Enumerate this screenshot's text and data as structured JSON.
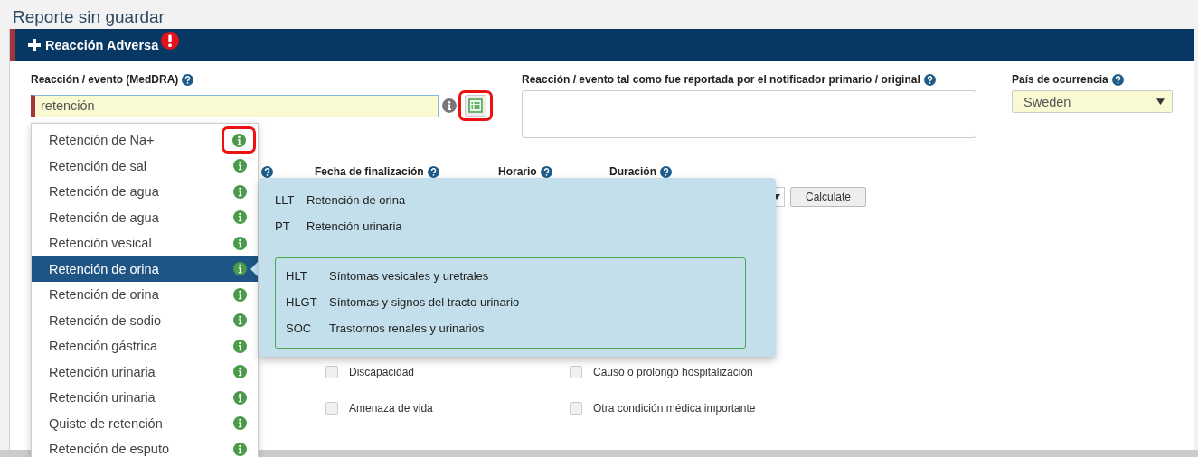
{
  "page_title": "Reporte sin guardar",
  "section": {
    "title": "Reacción Adversa",
    "has_error": true
  },
  "fields": {
    "reaction": {
      "label": "Reacción / evento (MedDRA)",
      "value": "retención",
      "required": true
    },
    "reported": {
      "label": "Reacción / evento tal como fue reportada por el notificador primario / original"
    },
    "country": {
      "label": "País de ocurrencia",
      "value": "Sweden"
    }
  },
  "date_labels": [
    {
      "label": "Fecha de finalización"
    },
    {
      "label": "Horario"
    },
    {
      "label": "Duración"
    }
  ],
  "calculate_button": "Calculate",
  "criteria": [
    {
      "label": "Discapacidad",
      "checked": false
    },
    {
      "label": "Causó o prolongó hospitalización",
      "checked": false
    },
    {
      "label": "Amenaza de vida",
      "checked": false
    },
    {
      "label": "Otra condición médica importante",
      "checked": false
    }
  ],
  "suggestions": [
    {
      "label": "Retención de Na+",
      "selected": false
    },
    {
      "label": "Retención de sal",
      "selected": false
    },
    {
      "label": "Retención de agua",
      "selected": false
    },
    {
      "label": "Retención de agua",
      "selected": false
    },
    {
      "label": "Retención vesical",
      "selected": false
    },
    {
      "label": "Retención de orina",
      "selected": true
    },
    {
      "label": "Retención de orina",
      "selected": false
    },
    {
      "label": "Retención de sodio",
      "selected": false
    },
    {
      "label": "Retención gástrica",
      "selected": false
    },
    {
      "label": "Retención urinaria",
      "selected": false
    },
    {
      "label": "Retención urinaria",
      "selected": false
    },
    {
      "label": "Quiste de retención",
      "selected": false
    },
    {
      "label": "Retención de esputo",
      "selected": false
    }
  ],
  "term_info": {
    "terms": [
      {
        "level": "LLT",
        "term": "Retención de orina"
      },
      {
        "level": "PT",
        "term": "Retención urinaria"
      }
    ],
    "hierarchy": [
      {
        "level": "HLT",
        "term": "Síntomas vesicales y uretrales"
      },
      {
        "level": "HLGT",
        "term": "Síntomas y signos del tracto urinario"
      },
      {
        "level": "SOC",
        "term": "Trastornos renales y urinarios"
      }
    ]
  }
}
